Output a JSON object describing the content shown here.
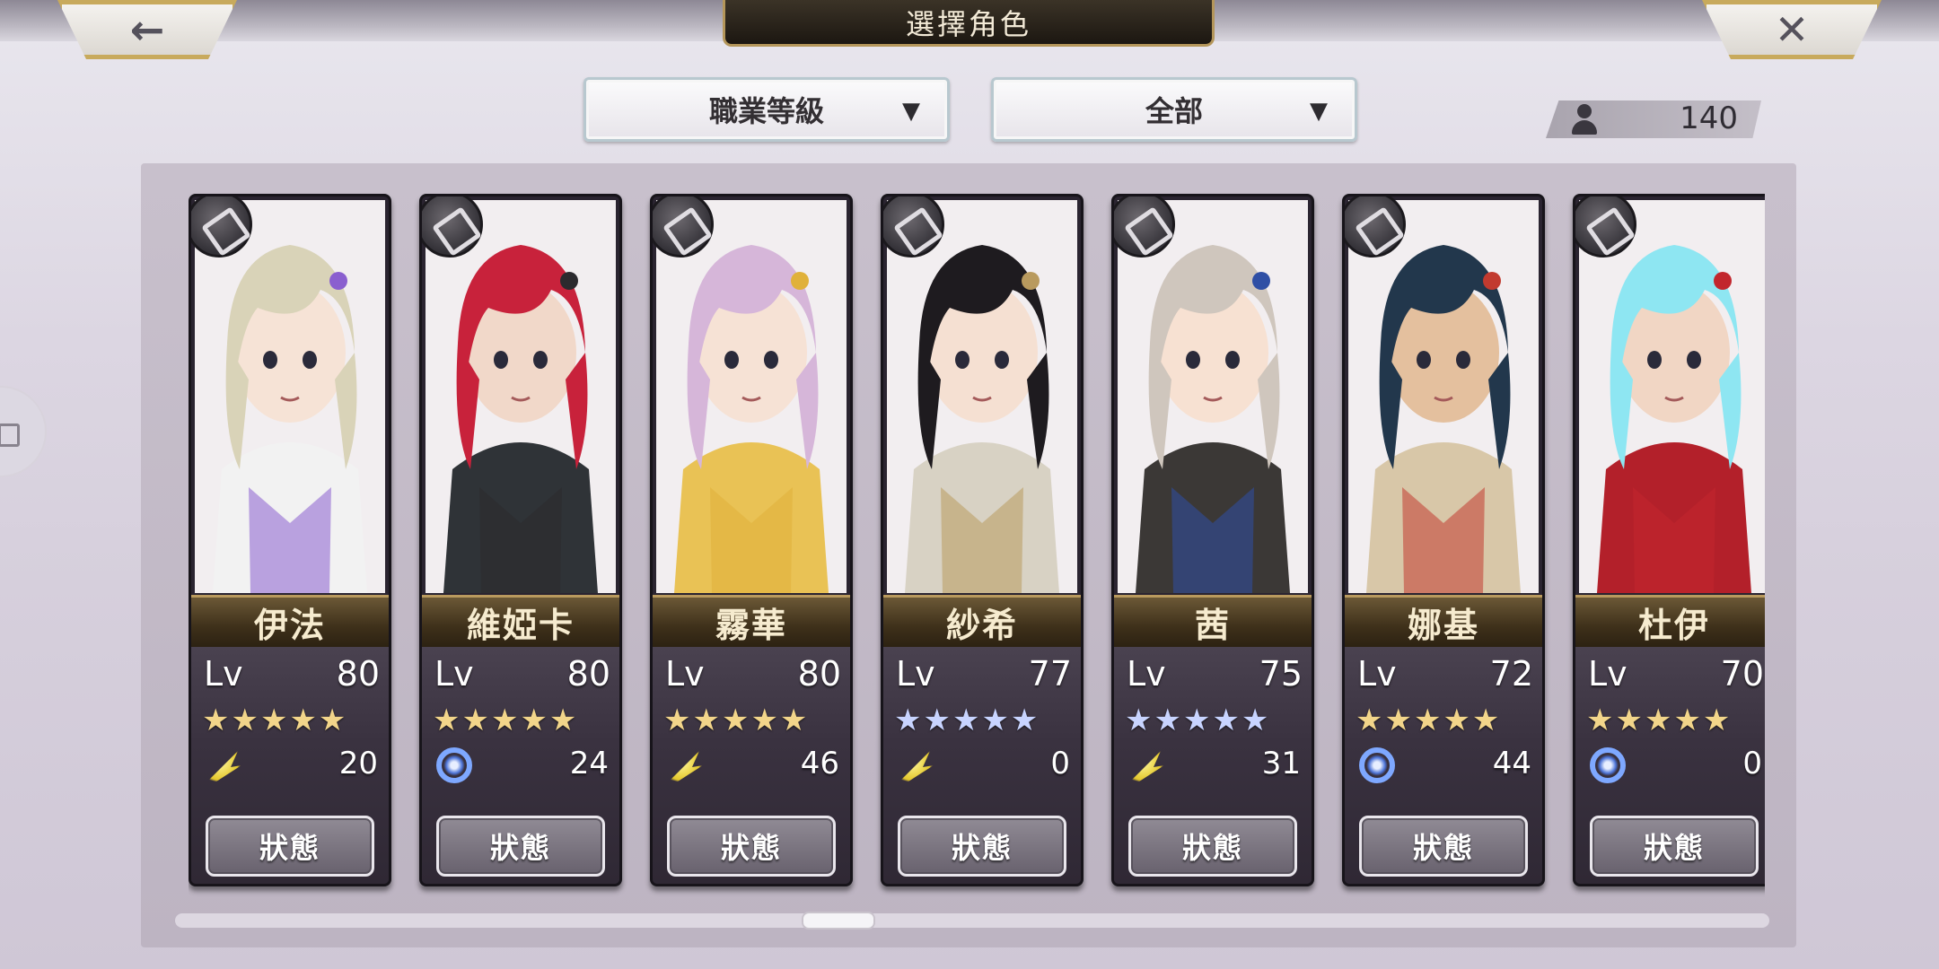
{
  "header": {
    "title": "選擇角色",
    "back_icon": "←",
    "close_icon": "✕"
  },
  "filters": {
    "sort": {
      "value": "職業等級",
      "chevron": "▼"
    },
    "category": {
      "value": "全部",
      "chevron": "▼"
    }
  },
  "roster_count": "140",
  "level_label": "Lv",
  "status_label": "狀態",
  "characters": [
    {
      "name": "伊法",
      "level": "80",
      "stars": "★★★★★",
      "star_color": "gold",
      "element": "wind",
      "points": "20",
      "art": {
        "hair": "#d9d3b8",
        "accent": "#8a5fcf",
        "skin": "#f6e3d6",
        "outfit": "#f2f2f2"
      }
    },
    {
      "name": "維婭卡",
      "level": "80",
      "stars": "★★★★★",
      "star_color": "gold",
      "element": "spiral",
      "points": "24",
      "art": {
        "hair": "#c8223b",
        "accent": "#2b2a2e",
        "skin": "#f1d8c9",
        "outfit": "#2f3337"
      }
    },
    {
      "name": "霧華",
      "level": "80",
      "stars": "★★★★★",
      "star_color": "gold",
      "element": "wind",
      "points": "46",
      "art": {
        "hair": "#d6b6d9",
        "accent": "#e0b13a",
        "skin": "#f6e2d5",
        "outfit": "#e9c255"
      }
    },
    {
      "name": "紗希",
      "level": "77",
      "stars": "★★★★★",
      "star_color": "blue",
      "element": "wind",
      "points": "0",
      "art": {
        "hair": "#1e1b1f",
        "accent": "#b99a5e",
        "skin": "#f5e0d2",
        "outfit": "#d8d2c4"
      }
    },
    {
      "name": "茜",
      "level": "75",
      "stars": "★★★★★",
      "star_color": "blue",
      "element": "wind",
      "points": "31",
      "art": {
        "hair": "#cfc6bd",
        "accent": "#2f4fa5",
        "skin": "#f7e1d2",
        "outfit": "#3b3836"
      }
    },
    {
      "name": "娜基",
      "level": "72",
      "stars": "★★★★★",
      "star_color": "gold",
      "element": "spiral",
      "points": "44",
      "art": {
        "hair": "#22374c",
        "accent": "#c23a2f",
        "skin": "#e4c09e",
        "outfit": "#d8c7a8"
      }
    },
    {
      "name": "杜伊",
      "level": "70",
      "stars": "★★★★★",
      "star_color": "gold",
      "element": "spiral",
      "points": "0",
      "art": {
        "hair": "#8ee6f2",
        "accent": "#c2262d",
        "skin": "#f1d6c4",
        "outfit": "#b3202a"
      }
    }
  ]
}
